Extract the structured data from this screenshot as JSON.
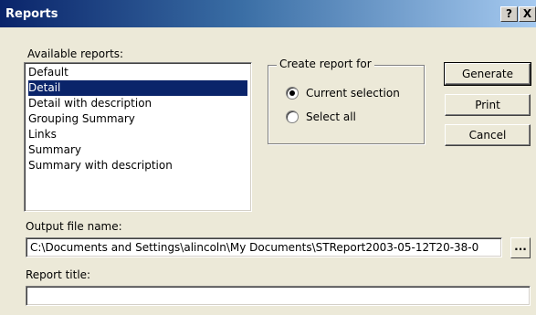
{
  "window": {
    "title": "Reports",
    "help_label": "?",
    "close_label": "X"
  },
  "reports": {
    "label": "Available reports:",
    "items": [
      "Default",
      "Detail",
      "Detail with description",
      "Grouping Summary",
      "Links",
      "Summary",
      "Summary with description"
    ],
    "selected_index": 1
  },
  "create_for": {
    "legend": "Create report for",
    "options": [
      "Current selection",
      "Select all"
    ],
    "selected": "Current selection"
  },
  "buttons": {
    "generate": "Generate",
    "print": "Print",
    "cancel": "Cancel",
    "browse": "..."
  },
  "output": {
    "label": "Output file name:",
    "value": "C:\\Documents and Settings\\alincoln\\My Documents\\STReport2003-05-12T20-38-0"
  },
  "report_title": {
    "label": "Report title:",
    "value": ""
  },
  "colors": {
    "selection": "#0a246a",
    "face": "#ece9d8"
  }
}
